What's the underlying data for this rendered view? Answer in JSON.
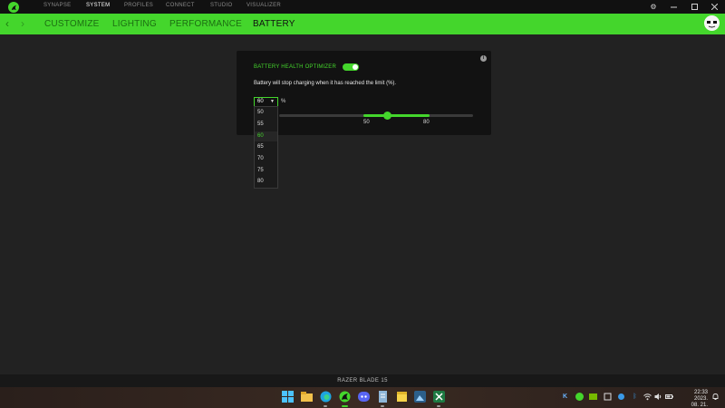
{
  "app": {
    "brand_color": "#44d62c",
    "logo_icon": "razer-snake-icon"
  },
  "top_nav": {
    "items": [
      {
        "label": "SYNAPSE",
        "active": false
      },
      {
        "label": "SYSTEM",
        "active": true
      },
      {
        "label": "PROFILES",
        "active": false
      },
      {
        "label": "CONNECT",
        "active": false
      },
      {
        "label": "STUDIO",
        "active": false
      },
      {
        "label": "VISUALIZER",
        "active": false
      }
    ],
    "window_controls": [
      "settings-gear-icon",
      "minimize-icon",
      "maximize-icon",
      "close-icon"
    ]
  },
  "sub_nav": {
    "tabs": [
      {
        "label": "CUSTOMIZE",
        "active": false
      },
      {
        "label": "LIGHTING",
        "active": false
      },
      {
        "label": "PERFORMANCE",
        "active": false
      },
      {
        "label": "BATTERY",
        "active": true
      }
    ]
  },
  "battery": {
    "optimizer_title": "BATTERY HEALTH OPTIMIZER",
    "optimizer_enabled": true,
    "description": "Battery will stop charging when it has reached the limit (%).",
    "limit_value": "60",
    "unit": "%",
    "slider": {
      "range": [
        50,
        80
      ],
      "value": 60,
      "labels": [
        "50",
        "80"
      ]
    },
    "dropdown_options": [
      "50",
      "55",
      "60",
      "65",
      "70",
      "75",
      "80"
    ],
    "selected_option": "60"
  },
  "device": {
    "name": "RAZER BLADE 15"
  },
  "taskbar": {
    "apps": [
      "windows-start-icon",
      "file-explorer-icon",
      "edge-browser-icon",
      "razer-synapse-icon",
      "discord-icon",
      "notepad-icon",
      "sticky-notes-icon",
      "photos-icon",
      "excel-icon"
    ],
    "tray_icons": [
      "k-app-icon",
      "telegram-icon",
      "nvidia-icon",
      "network-tray-icon",
      "bluetooth-icon",
      "wifi-icon",
      "volume-icon",
      "battery-icon"
    ],
    "time": "22:33",
    "date": "2023. 08. 21."
  }
}
